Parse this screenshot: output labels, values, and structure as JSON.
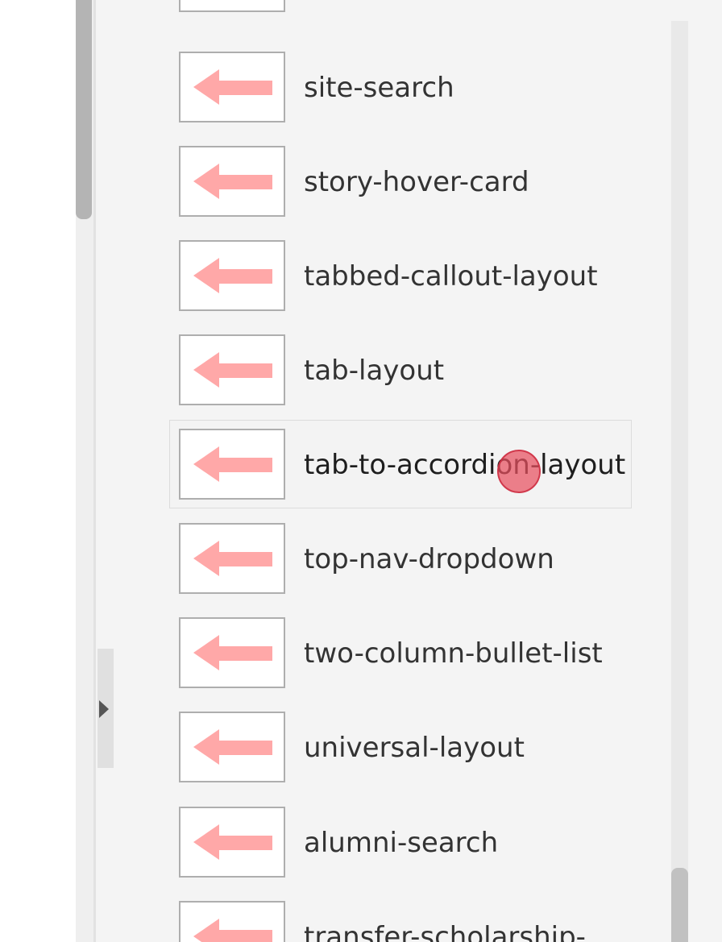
{
  "list": {
    "items": [
      {
        "label": ""
      },
      {
        "label": "site-search"
      },
      {
        "label": "story-hover-card"
      },
      {
        "label": "tabbed-callout-layout"
      },
      {
        "label": "tab-layout"
      },
      {
        "label": "tab-to-accordion-layout"
      },
      {
        "label": "top-nav-dropdown"
      },
      {
        "label": "two-column-bullet-list"
      },
      {
        "label": "universal-layout"
      },
      {
        "label": "alumni-search"
      },
      {
        "label": "transfer-scholarship-"
      }
    ]
  },
  "icons": {
    "item_thumbnail": "left-arrow-icon",
    "collapse": "chevron-right-icon"
  },
  "colors": {
    "arrow": "#ffa8a8",
    "panel": "#f4f4f4",
    "click_marker": "#e85060"
  }
}
